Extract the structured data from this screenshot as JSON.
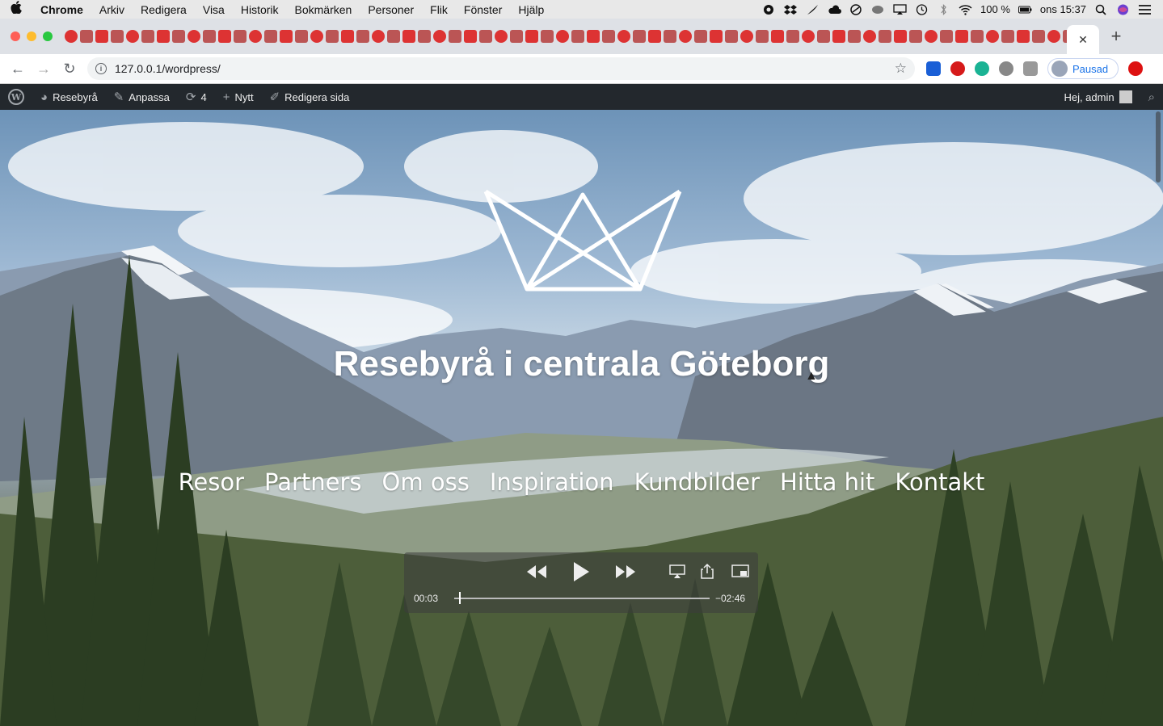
{
  "macos_menubar": {
    "app_name": "Chrome",
    "menus": [
      "Arkiv",
      "Redigera",
      "Visa",
      "Historik",
      "Bokmärken",
      "Personer",
      "Flik",
      "Fönster",
      "Hjälp"
    ],
    "battery": "100 %",
    "clock": "ons 15:37"
  },
  "browser": {
    "url": "127.0.0.1/wordpress/",
    "profile_label": "Pausad",
    "tab_close": "✕",
    "new_tab": "+"
  },
  "wp_admin_bar": {
    "site_name": "Resebyrå",
    "customize": "Anpassa",
    "updates_count": "4",
    "new": "Nytt",
    "edit_page": "Redigera sida",
    "greeting": "Hej, admin"
  },
  "hero": {
    "site_title": "Resebyrå i centrala Göteborg",
    "nav": [
      "Resor",
      "Partners",
      "Om oss",
      "Inspiration",
      "Kundbilder",
      "Hitta hit",
      "Kontakt"
    ]
  },
  "video": {
    "elapsed": "00:03",
    "remaining": "−02:46",
    "progress_fraction": 0.02
  },
  "colors": {
    "wp_bar": "#23282d",
    "tabstrip": "#dee1e6",
    "link_blue": "#1a73e8"
  }
}
